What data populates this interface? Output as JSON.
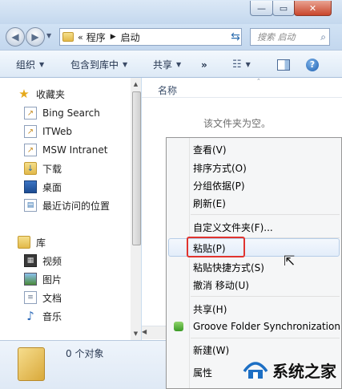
{
  "address": {
    "path": [
      "程序",
      "启动"
    ],
    "overflow": "«"
  },
  "search": {
    "placeholder": "搜索 启动"
  },
  "toolbar": {
    "organize": "组织",
    "include_in_library": "包含到库中",
    "share": "共享",
    "more": "»"
  },
  "sidebar": {
    "favorites_header": "收藏夹",
    "favorites": [
      "Bing Search",
      "ITWeb",
      "MSW Intranet",
      "下载",
      "桌面",
      "最近访问的位置"
    ],
    "libraries_header": "库",
    "libraries": [
      "视频",
      "图片",
      "文档",
      "音乐"
    ]
  },
  "content": {
    "column_name": "名称",
    "empty_message": "该文件夹为空。"
  },
  "details": {
    "item_count": "0 个对象"
  },
  "context_menu": {
    "view": "查看(V)",
    "sort_by": "排序方式(O)",
    "group_by": "分组依据(P)",
    "refresh": "刷新(E)",
    "customize_folder": "自定义文件夹(F)...",
    "paste": "粘贴(P)",
    "paste_shortcut": "粘贴快捷方式(S)",
    "undo_move": "撤消 移动(U)",
    "share_with": "共享(H)",
    "groove": "Groove Folder Synchronization",
    "new": "新建(W)",
    "properties": "属性"
  },
  "watermark": {
    "text": "系统之家"
  },
  "colors": {
    "highlight_border": "#e0342f",
    "accent": "#2f6fb0"
  },
  "icons": [
    "back-icon",
    "forward-icon",
    "folder-icon",
    "refresh-icon",
    "search-icon",
    "view-icon",
    "preview-pane-icon",
    "help-icon",
    "star-icon",
    "library-icon",
    "cursor-icon"
  ]
}
